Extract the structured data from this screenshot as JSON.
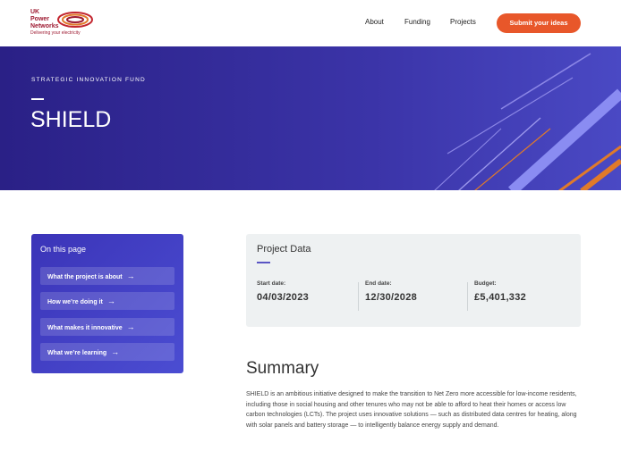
{
  "brand": {
    "name_line1": "UK",
    "name_line2": "Power",
    "name_line3": "Networks",
    "tagline": "Delivering your electricity",
    "color": "#9e1b32"
  },
  "nav": {
    "about": "About",
    "funding": "Funding",
    "projects": "Projects",
    "cta": "Submit your ideas"
  },
  "hero": {
    "kicker": "STRATEGIC INNOVATION FUND",
    "title": "SHIELD"
  },
  "on_this_page": {
    "title": "On this page",
    "items": [
      {
        "label": "What the project is about"
      },
      {
        "label": "How we’re doing it"
      },
      {
        "label": "What makes it innovative"
      },
      {
        "label": "What we’re learning"
      }
    ],
    "arrow_icon": "arrow-right-icon"
  },
  "project_data": {
    "title": "Project Data",
    "start_label": "Start date:",
    "start_value": "04/03/2023",
    "end_label": "End date:",
    "end_value": "12/30/2028",
    "budget_label": "Budget:",
    "budget_value": "£5,401,332"
  },
  "summary": {
    "title": "Summary",
    "body": "SHIELD is an ambitious initiative designed to make the transition to Net Zero more accessible for low-income residents, including those in social housing and other tenures who may not be able to afford to heat their homes or access low carbon technologies (LCTs). The project uses innovative solutions — such as distributed data centres for heating, along with solar panels and battery storage — to intelligently balance energy supply and demand."
  },
  "colors": {
    "accent": "#e8572a",
    "hero_bg": "#2a2086",
    "panel": "#4b4dd2"
  }
}
